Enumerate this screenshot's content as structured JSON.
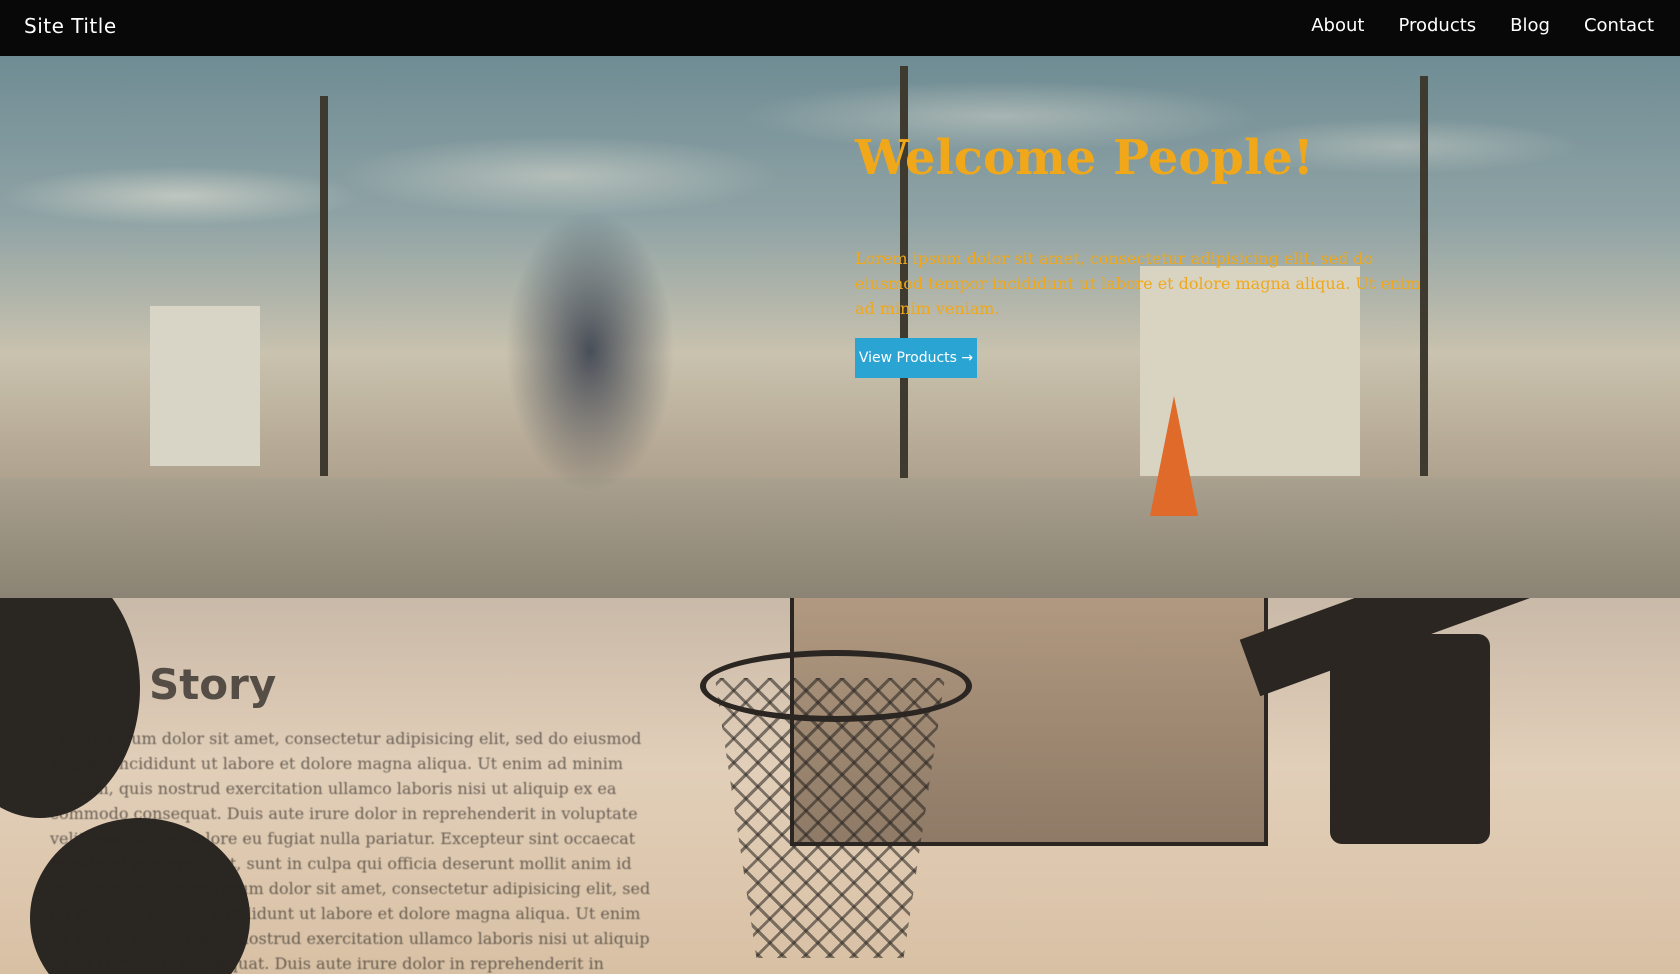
{
  "nav": {
    "site_title": "Site Title",
    "links": [
      "About",
      "Products",
      "Blog",
      "Contact"
    ]
  },
  "hero": {
    "title": "Welcome People!",
    "text": "Lorem ipsum dolor sit amet, consectetur adipisicing elit, sed do eiusmod tempor incididunt ut labore et dolore magna aliqua. Ut enim ad minim veniam.",
    "button_label": "View Products →"
  },
  "story": {
    "title": "Our Story",
    "text": "Lorem ipsum dolor sit amet, consectetur adipisicing elit, sed do eiusmod tempor incididunt ut labore et dolore magna aliqua. Ut enim ad minim veniam, quis nostrud exercitation ullamco laboris nisi ut aliquip ex ea commodo consequat. Duis aute irure dolor in reprehenderit in voluptate velit esse cillum dolore eu fugiat nulla pariatur. Excepteur sint occaecat cupidatat non proident, sunt in culpa qui officia deserunt mollit anim id est laborum. Lorem ipsum dolor sit amet, consectetur adipisicing elit, sed do eiusmod tempor incididunt ut labore et dolore magna aliqua. Ut enim ad minim veniam, quis nostrud exercitation ullamco laboris nisi ut aliquip ex ea commodo consequat. Duis aute irure dolor in reprehenderit in voluptate"
  },
  "colors": {
    "nav_bg": "#080808",
    "hero_text": "#f0a81a",
    "button_bg": "#2aa4d3"
  }
}
